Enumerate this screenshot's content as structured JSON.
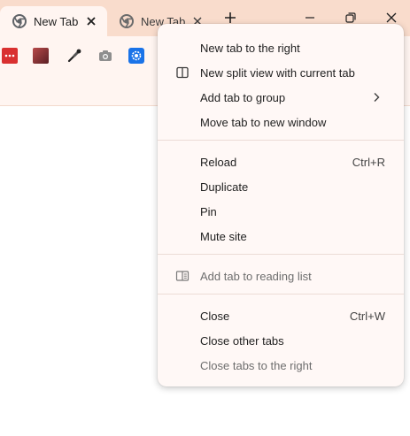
{
  "tabs": [
    {
      "title": "New Tab",
      "favicon": "chrome-icon",
      "active": true
    },
    {
      "title": "New Tab",
      "favicon": "chrome-icon",
      "active": false
    }
  ],
  "colors": {
    "titlebar": "#f9dccc",
    "toolbar": "#fff5f1",
    "menu_bg": "#fff8f6"
  },
  "extensions": [
    {
      "icon": "red-dots-extension-icon",
      "color": "#d93030"
    },
    {
      "icon": "photo-extension-icon",
      "color": "#8a3030"
    },
    {
      "icon": "eyedropper-icon",
      "color": "#222222"
    },
    {
      "icon": "camera-icon",
      "color": "#8e8e8e"
    },
    {
      "icon": "gear-extension-icon",
      "color": "#1a73e8"
    }
  ],
  "context_menu": {
    "groups": [
      [
        {
          "label": "New tab to the right",
          "shortcut": "",
          "icon": "",
          "submenu": false,
          "disabled": false
        },
        {
          "label": "New split view with current tab",
          "shortcut": "",
          "icon": "split-view-icon",
          "submenu": false,
          "disabled": false
        },
        {
          "label": "Add tab to group",
          "shortcut": "",
          "icon": "",
          "submenu": true,
          "disabled": false
        },
        {
          "label": "Move tab to new window",
          "shortcut": "",
          "icon": "",
          "submenu": false,
          "disabled": false
        }
      ],
      [
        {
          "label": "Reload",
          "shortcut": "Ctrl+R",
          "icon": "",
          "submenu": false,
          "disabled": false
        },
        {
          "label": "Duplicate",
          "shortcut": "",
          "icon": "",
          "submenu": false,
          "disabled": false
        },
        {
          "label": "Pin",
          "shortcut": "",
          "icon": "",
          "submenu": false,
          "disabled": false
        },
        {
          "label": "Mute site",
          "shortcut": "",
          "icon": "",
          "submenu": false,
          "disabled": false
        }
      ],
      [
        {
          "label": "Add tab to reading list",
          "shortcut": "",
          "icon": "reading-list-icon",
          "submenu": false,
          "disabled": true
        }
      ],
      [
        {
          "label": "Close",
          "shortcut": "Ctrl+W",
          "icon": "",
          "submenu": false,
          "disabled": false
        },
        {
          "label": "Close other tabs",
          "shortcut": "",
          "icon": "",
          "submenu": false,
          "disabled": false
        },
        {
          "label": "Close tabs to the right",
          "shortcut": "",
          "icon": "",
          "submenu": false,
          "disabled": true
        }
      ]
    ]
  }
}
